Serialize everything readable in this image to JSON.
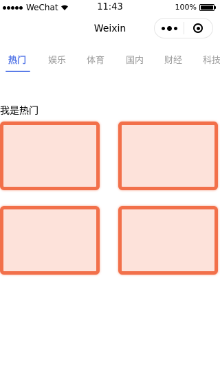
{
  "status_bar": {
    "carrier": "WeChat",
    "time": "11:43",
    "battery": "100%",
    "battery_level": 1.0
  },
  "nav": {
    "title": "Weixin"
  },
  "tabs": [
    {
      "label": "热门",
      "active": true
    },
    {
      "label": "娱乐",
      "active": false
    },
    {
      "label": "体育",
      "active": false
    },
    {
      "label": "国内",
      "active": false
    },
    {
      "label": "财经",
      "active": false
    },
    {
      "label": "科技",
      "active": false
    }
  ],
  "content": {
    "heading": "我是热门",
    "card_count": 4
  },
  "colors": {
    "accent": "#5b7ce8",
    "card_fill": "#fde2da",
    "card_border": "#f2704a",
    "inactive_tab": "#999999"
  }
}
